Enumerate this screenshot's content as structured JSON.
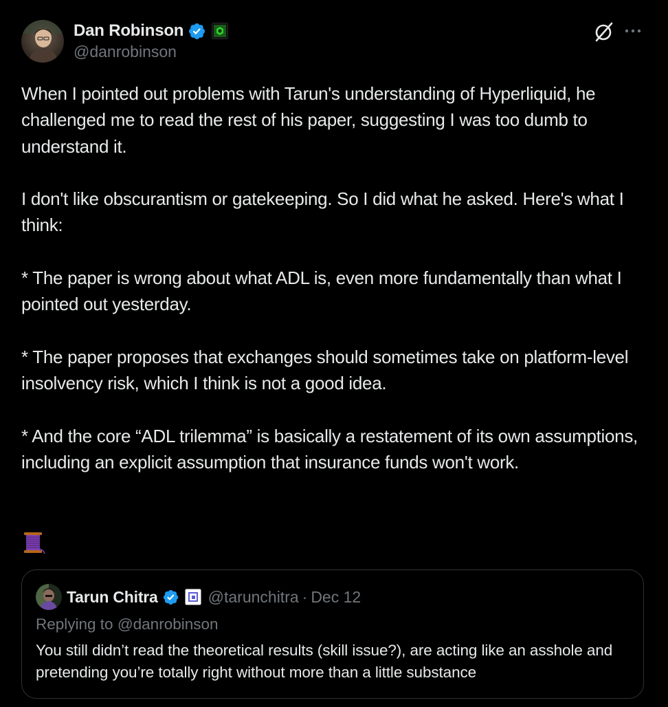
{
  "author": {
    "display_name": "Dan Robinson",
    "handle": "@danrobinson",
    "verified_icon": "verified-badge-icon",
    "affiliation_icon": "paradigm-affiliation-icon"
  },
  "actions": {
    "grok_icon": "grok-icon",
    "more_icon": "more-options-icon"
  },
  "body": {
    "paragraphs": [
      "When I pointed out problems with Tarun's understanding of Hyperliquid, he challenged me to read the rest of his paper, suggesting I was too dumb to understand it.",
      "I don't like obscurantism or gatekeeping. So I did what he asked. Here's what I think:",
      "* The paper is wrong about what ADL is, even more fundamentally than what I pointed out yesterday.",
      "* The paper proposes that exchanges should sometimes take on platform-level insolvency risk, which I think is not a good idea.",
      "* And the core “ADL trilemma” is basically a restatement of its own assumptions, including an explicit assumption that insurance funds won't work."
    ],
    "emoji": "🧵"
  },
  "quoted": {
    "display_name": "Tarun Chitra",
    "handle": "@tarunchitra",
    "separator": "·",
    "date": "Dec 12",
    "replying_to": "Replying to @danrobinson",
    "text": "You still didn’t read the theoretical results (skill issue?), are acting like an asshole and pretending you’re totally right without more than a little substance"
  },
  "colors": {
    "background": "#000000",
    "text": "#e7e9ea",
    "muted": "#71767b",
    "verified": "#1d9bf0",
    "border": "#2f3336"
  }
}
